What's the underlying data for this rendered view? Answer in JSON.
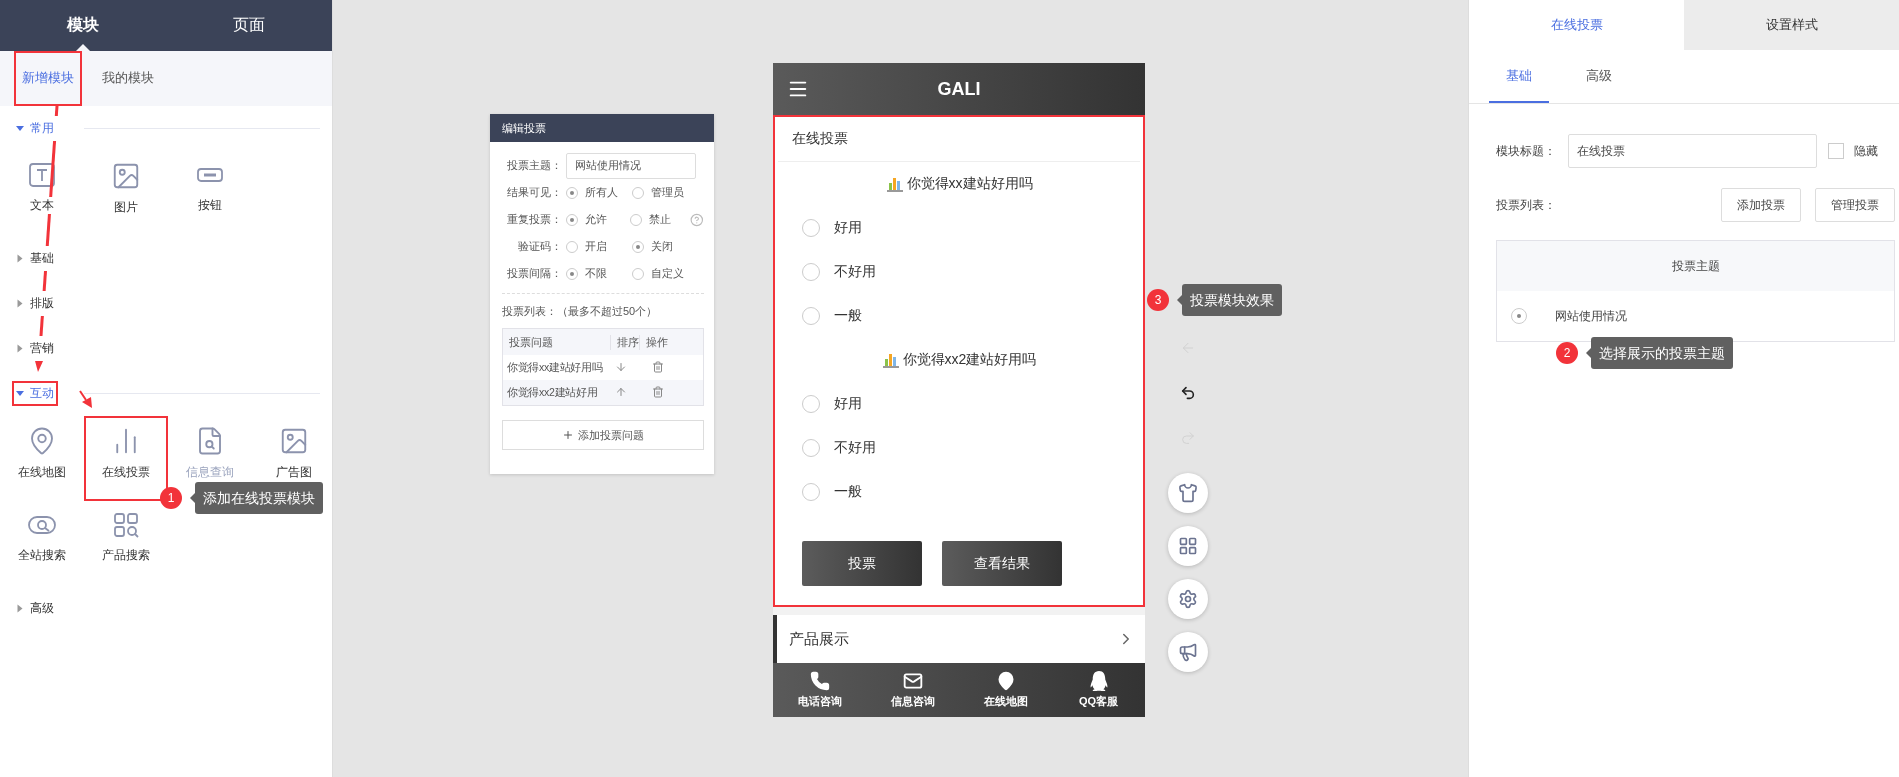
{
  "sidebar": {
    "tabs": [
      {
        "label": "模块",
        "selected": true
      },
      {
        "label": "页面",
        "selected": false
      }
    ],
    "subtabs": [
      {
        "label": "新增模块",
        "selected": true,
        "highlighted": true
      },
      {
        "label": "我的模块",
        "selected": false,
        "highlighted": false
      }
    ],
    "groups": [
      {
        "label": "常用",
        "expanded": true,
        "highlighted": false,
        "items": [
          {
            "label": "文本",
            "kind": "text",
            "disabled": false,
            "highlighted": false
          },
          {
            "label": "图片",
            "kind": "image",
            "disabled": false,
            "highlighted": false
          },
          {
            "label": "按钮",
            "kind": "button",
            "disabled": false,
            "highlighted": false
          }
        ]
      },
      {
        "label": "基础",
        "expanded": false,
        "highlighted": false
      },
      {
        "label": "排版",
        "expanded": false,
        "highlighted": false
      },
      {
        "label": "营销",
        "expanded": false,
        "highlighted": false
      },
      {
        "label": "互动",
        "expanded": true,
        "highlighted": true,
        "items": [
          {
            "label": "在线地图",
            "kind": "map",
            "disabled": false,
            "highlighted": false
          },
          {
            "label": "在线投票",
            "kind": "vote",
            "disabled": false,
            "highlighted": true
          },
          {
            "label": "信息查询",
            "kind": "query",
            "disabled": true,
            "highlighted": false
          },
          {
            "label": "广告图",
            "kind": "image",
            "disabled": false,
            "highlighted": false
          },
          {
            "label": "全站搜索",
            "kind": "site-search",
            "disabled": false,
            "highlighted": false
          },
          {
            "label": "产品搜索",
            "kind": "product-search",
            "disabled": false,
            "highlighted": false
          }
        ]
      },
      {
        "label": "高级",
        "expanded": false,
        "highlighted": false
      }
    ]
  },
  "editor": {
    "title": "编辑投票",
    "topic": {
      "label": "投票主题：",
      "value": "网站使用情况"
    },
    "options": [
      {
        "label": "结果可见：",
        "help": false,
        "choices": [
          {
            "label": "所有人",
            "selected": true
          },
          {
            "label": "管理员",
            "selected": false
          }
        ]
      },
      {
        "label": "重复投票：",
        "help": true,
        "choices": [
          {
            "label": "允许",
            "selected": true
          },
          {
            "label": "禁止",
            "selected": false
          }
        ]
      },
      {
        "label": "验证码：",
        "help": false,
        "choices": [
          {
            "label": "开启",
            "selected": false
          },
          {
            "label": "关闭",
            "selected": true
          }
        ]
      },
      {
        "label": "投票间隔：",
        "help": false,
        "choices": [
          {
            "label": "不限",
            "selected": true
          },
          {
            "label": "自定义",
            "selected": false
          }
        ]
      }
    ],
    "list_label": "投票列表：（最多不超过50个）",
    "columns": [
      "投票问题",
      "排序",
      "操作"
    ],
    "rows": [
      {
        "question": "你觉得xx建站好用吗",
        "kind": "down"
      },
      {
        "question": "你觉得xx2建站好用",
        "kind": "up"
      }
    ],
    "add_button": "添加投票问题"
  },
  "phone": {
    "title": "GALI",
    "module": {
      "title": "在线投票",
      "highlighted": true,
      "questions": [
        {
          "title": "你觉得xx建站好用吗",
          "options": [
            {
              "label": "好用",
              "selected": false
            },
            {
              "label": "不好用",
              "selected": false
            },
            {
              "label": "一般",
              "selected": false
            }
          ]
        },
        {
          "title": "你觉得xx2建站好用吗",
          "options": [
            {
              "label": "好用",
              "selected": false
            },
            {
              "label": "不好用",
              "selected": false
            },
            {
              "label": "一般",
              "selected": false
            }
          ]
        }
      ],
      "buttons": [
        "投票",
        "查看结果"
      ]
    },
    "section": "产品展示",
    "nav": [
      {
        "label": "电话咨询",
        "kind": "phone"
      },
      {
        "label": "信息咨询",
        "kind": "mail"
      },
      {
        "label": "在线地图",
        "kind": "pin"
      },
      {
        "label": "QQ客服",
        "kind": "qq"
      }
    ]
  },
  "tools": [
    {
      "kind": "back",
      "disabled": true
    },
    {
      "kind": "undo",
      "disabled": false
    },
    {
      "kind": "redo",
      "disabled": true
    },
    {
      "kind": "shirt",
      "disabled": false
    },
    {
      "kind": "grid",
      "disabled": false
    },
    {
      "kind": "settings",
      "disabled": false
    },
    {
      "kind": "speaker",
      "disabled": false
    }
  ],
  "panel": {
    "tabs": [
      {
        "label": "在线投票",
        "selected": true
      },
      {
        "label": "设置样式",
        "selected": false
      }
    ],
    "subtabs": [
      {
        "label": "基础",
        "selected": true
      },
      {
        "label": "高级",
        "selected": false
      }
    ],
    "title_label": "模块标题：",
    "title_value": "在线投票",
    "hide": {
      "label": "隐藏",
      "checked": false
    },
    "list_label": "投票列表：",
    "buttons": [
      "添加投票",
      "管理投票"
    ],
    "table_header": "投票主题",
    "rows": [
      {
        "label": "网站使用情况",
        "selected": true
      }
    ]
  },
  "annotations": [
    {
      "number": "1",
      "text": "添加在线投票模块"
    },
    {
      "number": "2",
      "text": "选择展示的投票主题"
    },
    {
      "number": "3",
      "text": "投票模块效果"
    }
  ]
}
